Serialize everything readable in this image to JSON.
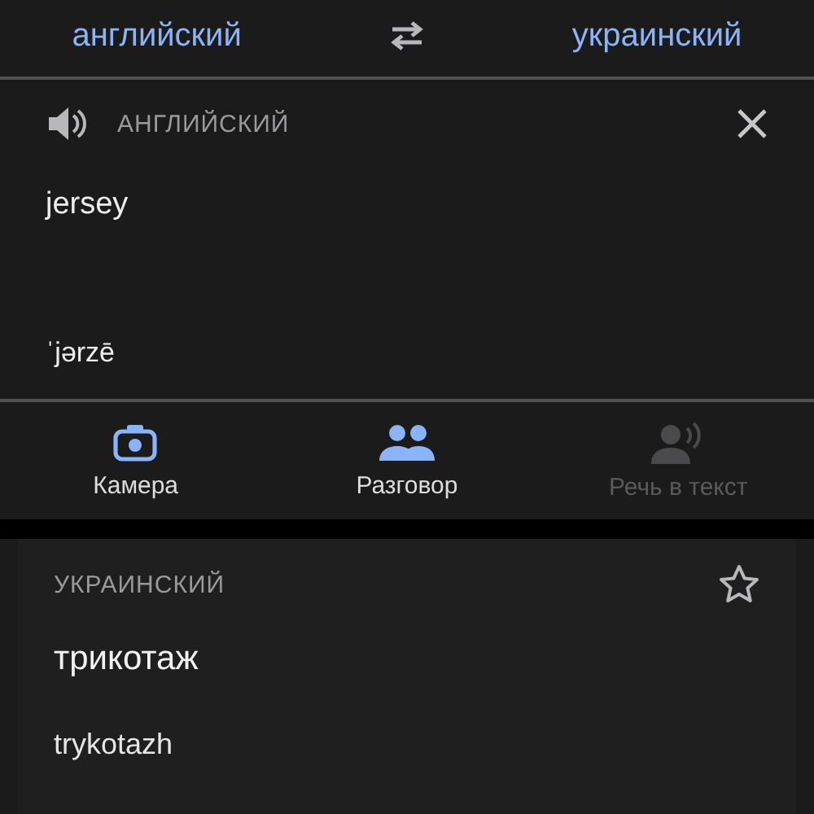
{
  "languages": {
    "source": "английский",
    "target": "украинский"
  },
  "input": {
    "language": "АНГЛИЙСКИЙ",
    "text": "jersey",
    "transcription": "ˈjərzē"
  },
  "modes": [
    {
      "kind": "camera",
      "label": "Камера",
      "disabled": false
    },
    {
      "kind": "conversation",
      "label": "Разговор",
      "disabled": false
    },
    {
      "kind": "speech",
      "label": "Речь в текст",
      "disabled": true
    }
  ],
  "result": {
    "language": "УКРАИНСКИЙ",
    "text": "трикотаж",
    "transliteration": "trykotazh",
    "starred": false
  }
}
